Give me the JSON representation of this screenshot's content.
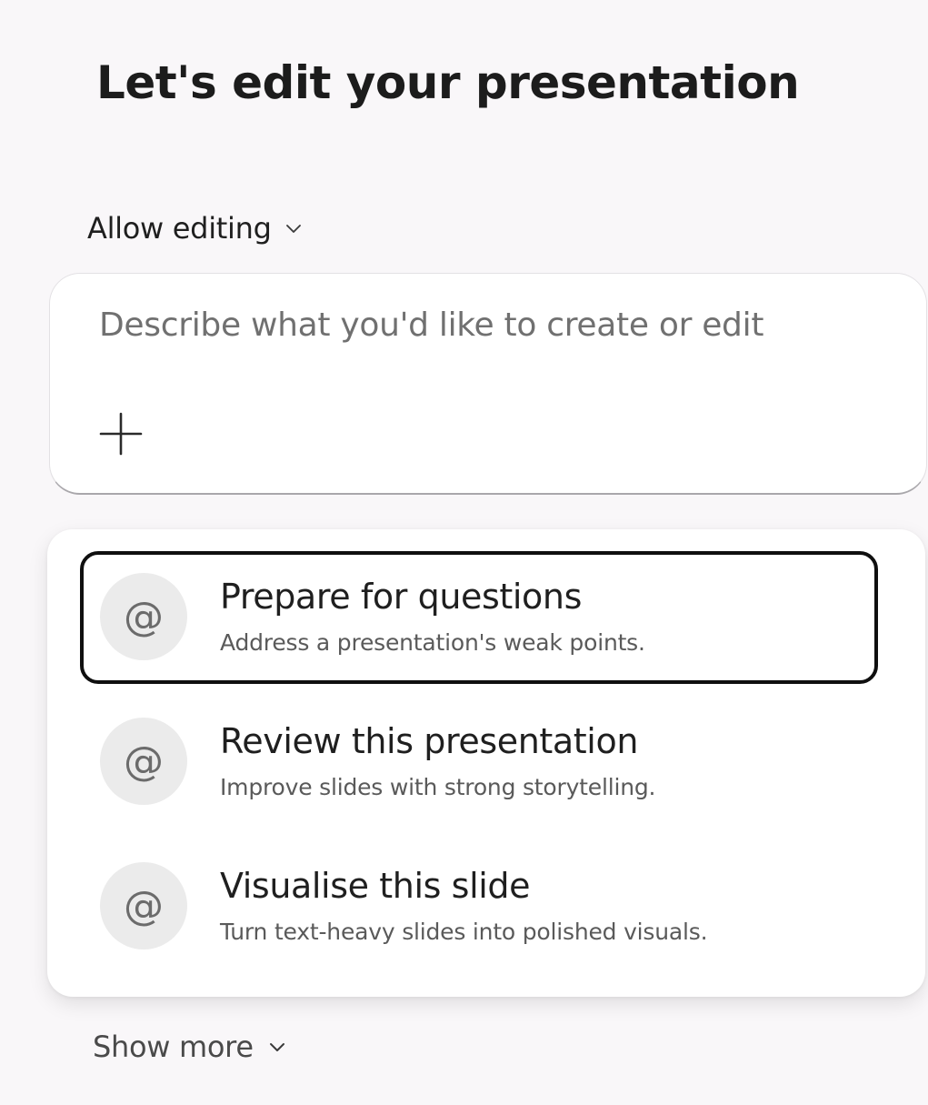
{
  "header": {
    "title": "Let's edit your presentation"
  },
  "mode_selector": {
    "label": "Allow editing",
    "icon": "chevron-down-icon"
  },
  "prompt": {
    "placeholder": "Describe what you'd like to create or edit",
    "value": "",
    "add_icon": "plus-icon"
  },
  "suggestions": [
    {
      "title": "Prepare for questions",
      "description": "Address a presentation's weak points.",
      "icon_glyph": "@",
      "focused": true
    },
    {
      "title": "Review this presentation",
      "description": "Improve slides with strong storytelling.",
      "icon_glyph": "@",
      "focused": false
    },
    {
      "title": "Visualise this slide",
      "description": "Turn text-heavy slides into polished visuals.",
      "icon_glyph": "@",
      "focused": false
    }
  ],
  "footer": {
    "show_more_label": "Show more"
  },
  "colors": {
    "background": "#f9f7f9",
    "card": "#ffffff",
    "icon_circle": "#ebebeb",
    "focus_ring": "#0f0f0f"
  }
}
